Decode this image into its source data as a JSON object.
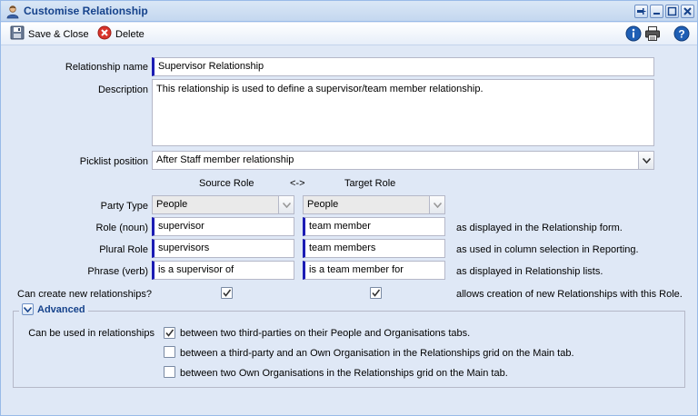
{
  "window": {
    "title": "Customise Relationship"
  },
  "toolbar": {
    "save_close": "Save & Close",
    "delete": "Delete"
  },
  "form": {
    "relationship_name_label": "Relationship name",
    "relationship_name_value": "Supervisor Relationship",
    "description_label": "Description",
    "description_value": "This relationship is used to define a supervisor/team member relationship.",
    "picklist_label": "Picklist position",
    "picklist_value": "After Staff member relationship",
    "source_role_header": "Source Role",
    "arrow_header": "<->",
    "target_role_header": "Target Role",
    "party_type_label": "Party Type",
    "party_type_source": "People",
    "party_type_target": "People",
    "role_noun_label": "Role (noun)",
    "role_noun_source": "supervisor",
    "role_noun_target": "team member",
    "role_noun_note": "as displayed in the Relationship form.",
    "plural_role_label": "Plural Role",
    "plural_role_source": "supervisors",
    "plural_role_target": "team members",
    "plural_role_note": "as used in column selection in Reporting.",
    "phrase_verb_label": "Phrase (verb)",
    "phrase_verb_source": "is a supervisor of",
    "phrase_verb_target": "is a team member for",
    "phrase_verb_note": "as displayed in Relationship lists.",
    "can_create_label": "Can create new relationships?",
    "can_create_source_checked": true,
    "can_create_target_checked": true,
    "can_create_note": "allows creation of new Relationships with this Role."
  },
  "advanced": {
    "legend": "Advanced",
    "used_in_label": "Can be used in relationships",
    "options": [
      {
        "label": "between two third-parties on their People and Organisations tabs.",
        "checked": true
      },
      {
        "label": "between a third-party and an Own Organisation in the Relationships grid on the Main tab.",
        "checked": false
      },
      {
        "label": "between two Own Organisations in the Relationships grid on the Main tab.",
        "checked": false
      }
    ]
  },
  "colors": {
    "title_text": "#15428b",
    "panel_bg": "#dfe8f6",
    "required_marker": "#1c1cb4",
    "delete_red": "#d9342b",
    "help_blue": "#1f5fb5"
  },
  "icons": {
    "title": "user-icon",
    "save": "floppy-disk-icon",
    "delete": "delete-icon",
    "info": "info-icon",
    "print": "printer-icon",
    "help": "help-icon"
  }
}
